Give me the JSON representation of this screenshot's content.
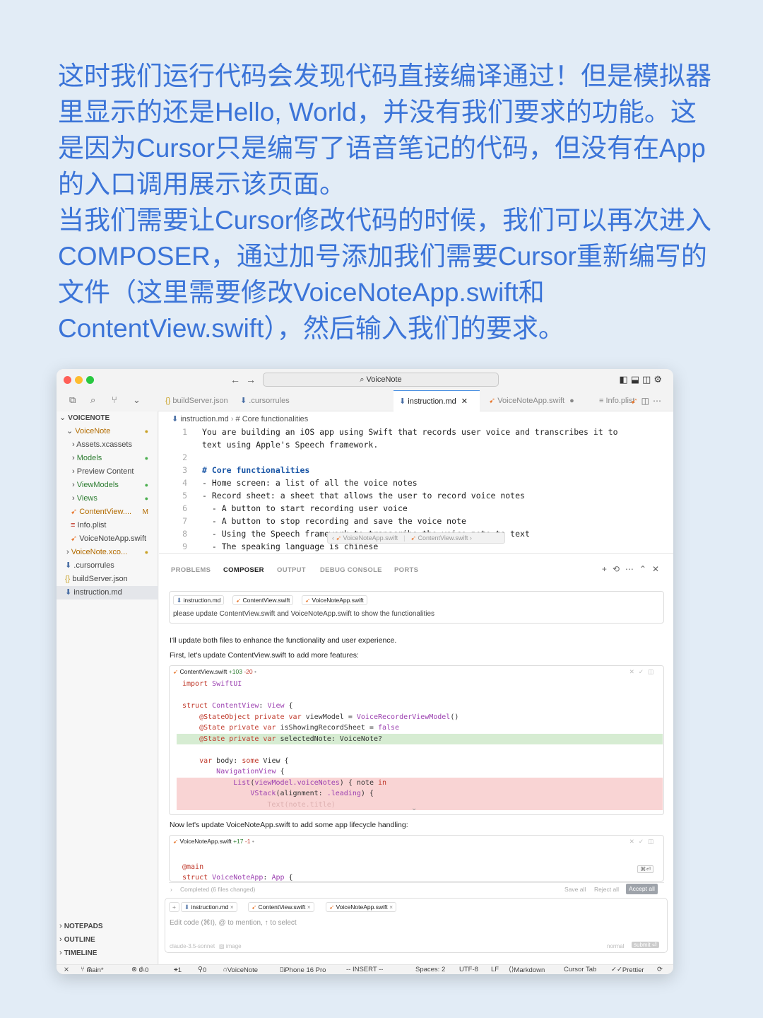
{
  "caption": {
    "p1": "这时我们运行代码会发现代码直接编译通过！但是模拟器里显示的还是Hello, World，并没有我们要求的功能。这是因为Cursor只是编写了语音笔记的代码，但没有在App的入口调用展示该页面。",
    "p2": "当我们需要让Cursor修改代码的时候，我们可以再次进入COMPOSER，通过加号添加我们需要Cursor重新编写的文件（这里需要修改VoiceNoteApp.swift和ContentView.swift），然后输入我们的要求。"
  },
  "window": {
    "search": "VoiceNote",
    "tabs": [
      "buildServer.json",
      ".cursorrules",
      "instruction.md",
      "VoiceNoteApp.swift",
      "Info.plist"
    ]
  },
  "sidebar": {
    "root": "VOICENOTE",
    "items": [
      "VoiceNote",
      "Assets.xcassets",
      "Models",
      "Preview Content",
      "ViewModels",
      "Views",
      "ContentView....",
      "Info.plist",
      "VoiceNoteApp.swift",
      "VoiceNote.xco...",
      ".cursorrules",
      "buildServer.json",
      "instruction.md"
    ],
    "modified_marker": "M",
    "sections": [
      "NOTEPADS",
      "OUTLINE",
      "TIMELINE"
    ]
  },
  "editor": {
    "breadcrumb_file": "instruction.md",
    "breadcrumb_section": "# Core functionalities",
    "lines": [
      {
        "n": "1",
        "text": "You are building an iOS app using Swift that records user voice and transcribes it to"
      },
      {
        "n": "",
        "text": "text using Apple's Speech framework."
      },
      {
        "n": "2",
        "text": ""
      },
      {
        "n": "3",
        "text": "# Core functionalities"
      },
      {
        "n": "4",
        "text": "- Home screen: a list of all the voice notes"
      },
      {
        "n": "5",
        "text": "- Record sheet: a sheet that allows the user to record voice notes"
      },
      {
        "n": "6",
        "text": "  - A button to start recording user voice"
      },
      {
        "n": "7",
        "text": "  - A button to stop recording and save the voice note"
      },
      {
        "n": "8",
        "text": "  - Using the Speech framework to transcribe the voice note to text"
      },
      {
        "n": "9",
        "text": "  - The speaking language is chinese"
      }
    ],
    "popup_file1": "VoiceNoteApp.swift",
    "popup_file2": "ContentView.swift"
  },
  "panel": {
    "tabs": [
      "PROBLEMS",
      "COMPOSER",
      "OUTPUT",
      "DEBUG CONSOLE",
      "PORTS"
    ],
    "request_chips": [
      "instruction.md",
      "ContentView.swift",
      "VoiceNoteApp.swift"
    ],
    "request_text": "please update ContentView.swift and VoiceNoteApp.swift to show the functionalities",
    "response_1": "I'll update both files to enhance the functionality and user experience.",
    "response_2": "First, let's update ContentView.swift to add more features:",
    "diff1_file": "ContentView.swift",
    "diff1_add": "+103",
    "diff1_del": "-20",
    "diff1_lines": [
      "import SwiftUI",
      "",
      "struct ContentView: View {",
      "    @StateObject private var viewModel = VoiceRecorderViewModel()",
      "    @State private var isShowingRecordSheet = false",
      "    @State private var selectedNote: VoiceNote?",
      "",
      "    var body: some View {",
      "        NavigationView {",
      "            List(viewModel.voiceNotes) { note in",
      "                VStack(alignment: .leading) {",
      "                    Text(note.title)"
    ],
    "response_3": "Now let's update VoiceNoteApp.swift to add some app lifecycle handling:",
    "diff2_file": "VoiceNoteApp.swift",
    "diff2_add": "+17",
    "diff2_del": "-1",
    "diff2_lines": [
      "@main",
      "struct VoiceNoteApp: App {"
    ],
    "shortcut": "⌘⏎",
    "completed": "Completed (6 files changed)",
    "save_all": "Save all",
    "reject_all": "Reject all",
    "accept_all": "Accept all",
    "input_chips": [
      "instruction.md",
      "ContentView.swift",
      "VoiceNoteApp.swift"
    ],
    "input_placeholder": "Edit code (⌘I), @ to mention, ↑ to select",
    "model": "claude-3.5-sonnet",
    "image_label": "image",
    "mode": "normal",
    "submit": "submit ⏎"
  },
  "statusbar": {
    "branch": "main*",
    "errors": "0",
    "warnings": "0",
    "sync": "1",
    "ports": "0",
    "project": "VoiceNote",
    "device": "iPhone 16 Pro",
    "mode": "-- INSERT --",
    "spaces": "Spaces: 2",
    "encoding": "UTF-8",
    "eol": "LF",
    "language": "Markdown",
    "cursor_tab": "Cursor Tab",
    "prettier": "Prettier"
  },
  "colors": {
    "caption": "#3b74d8",
    "swift": "#e8762c",
    "added": "#d6ecd2",
    "removed": "#f9d4d4"
  }
}
